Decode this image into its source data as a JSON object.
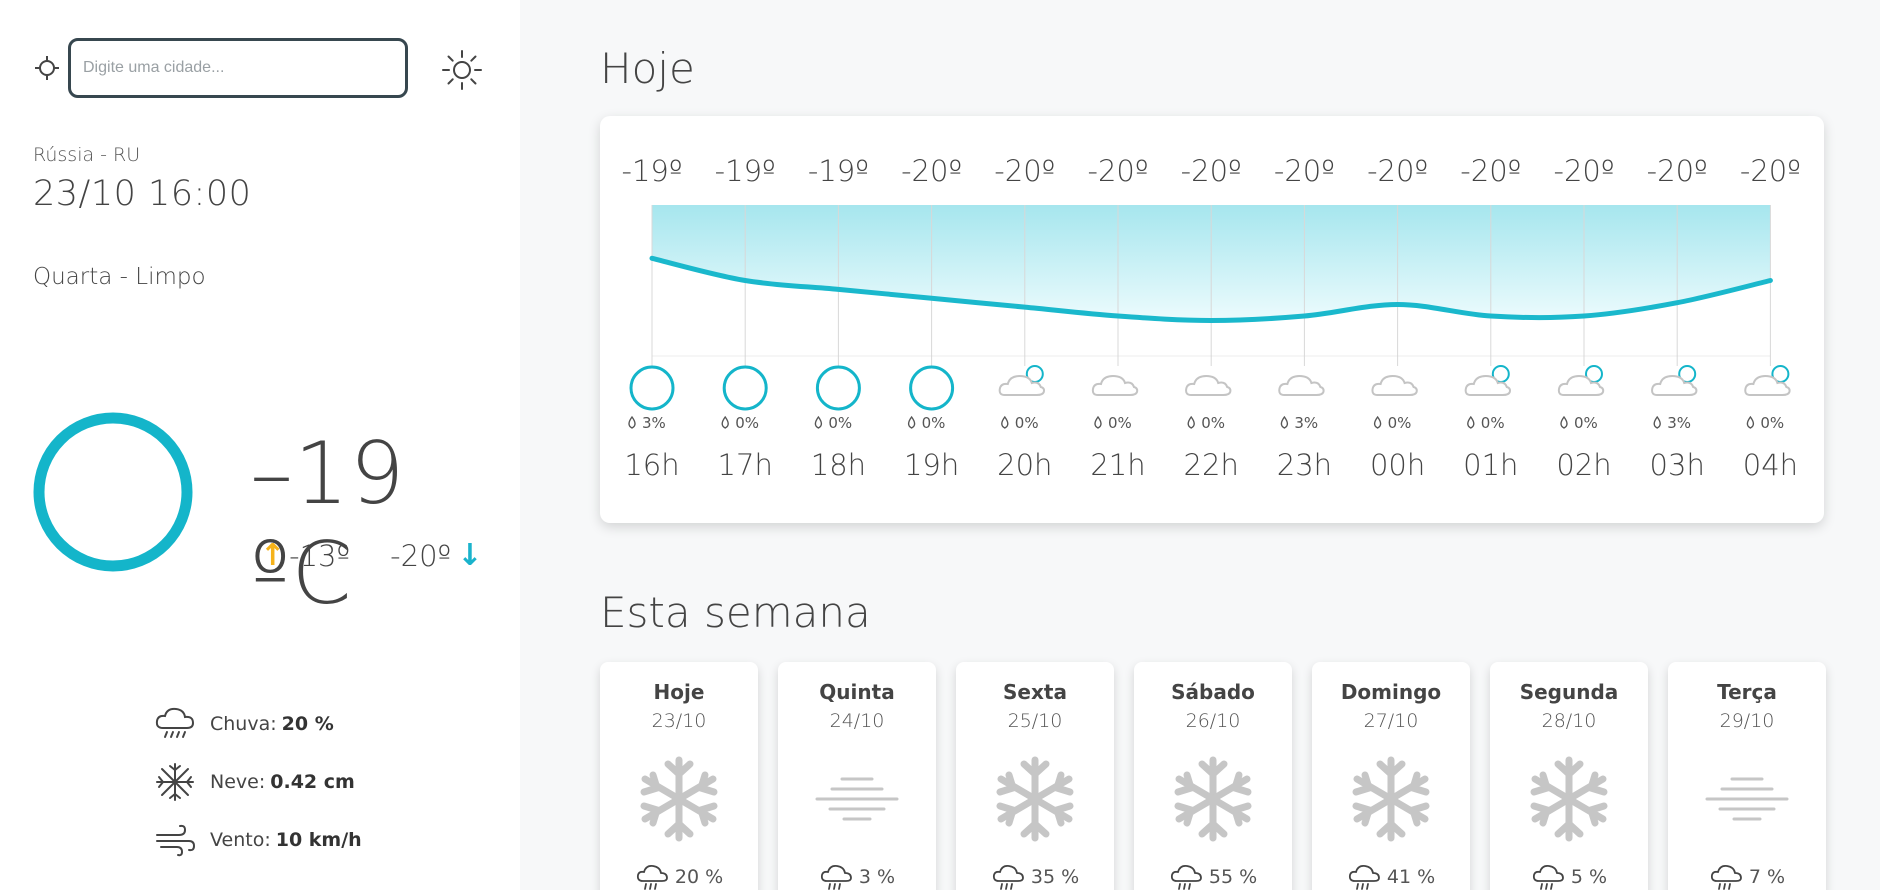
{
  "search": {
    "placeholder": "Digite uma cidade..."
  },
  "location": {
    "country": "Rússia - RU",
    "datetime": "23/10 16:00",
    "description": "Quarta - Limpo"
  },
  "current": {
    "temp": "–19 ºC",
    "max": "-13º",
    "min": "-20º"
  },
  "stats": [
    {
      "label": "Chuva:",
      "value": "20 %",
      "icon": "rain-cloud-icon"
    },
    {
      "label": "Neve:",
      "value": "0.42 cm",
      "icon": "snowflake-icon"
    },
    {
      "label": "Vento:",
      "value": "10 km/h",
      "icon": "wind-icon"
    }
  ],
  "sections": {
    "today": "Hoje",
    "week": "Esta semana"
  },
  "chart_data": {
    "type": "area",
    "x": [
      "16h",
      "17h",
      "18h",
      "19h",
      "20h",
      "21h",
      "22h",
      "23h",
      "00h",
      "01h",
      "02h",
      "03h",
      "04h"
    ],
    "temp_labels": [
      "-19º",
      "-19º",
      "-19º",
      "-20º",
      "-20º",
      "-20º",
      "-20º",
      "-20º",
      "-20º",
      "-20º",
      "-20º",
      "-20º",
      "-20º"
    ],
    "values": [
      -19.2,
      -19.45,
      -19.55,
      -19.65,
      -19.75,
      -19.85,
      -19.9,
      -19.85,
      -19.72,
      -19.85,
      -19.85,
      -19.7,
      -19.45
    ],
    "ylim": [
      -20.3,
      -18.6
    ],
    "rain": [
      "3%",
      "0%",
      "0%",
      "0%",
      "0%",
      "0%",
      "0%",
      "3%",
      "0%",
      "0%",
      "0%",
      "3%",
      "0%"
    ],
    "icons": [
      "clear-night-icon",
      "clear-night-icon",
      "clear-night-icon",
      "clear-night-icon",
      "cloudy-night-icon",
      "cloud-icon",
      "cloud-icon",
      "cloud-icon",
      "cloud-icon",
      "cloudy-night-icon",
      "cloudy-night-icon",
      "cloudy-night-icon",
      "cloudy-night-icon"
    ],
    "colors": {
      "line": "#1ab8cc",
      "fill_top": "#a6e6ee",
      "fill_bottom": "#ecfbfd",
      "grid": "#d8d8d8"
    }
  },
  "week": [
    {
      "name": "Hoje",
      "date": "23/10",
      "icon": "snowflake-icon",
      "rain": "20 %"
    },
    {
      "name": "Quinta",
      "date": "24/10",
      "icon": "fog-icon",
      "rain": "3 %"
    },
    {
      "name": "Sexta",
      "date": "25/10",
      "icon": "snowflake-icon",
      "rain": "35 %"
    },
    {
      "name": "Sábado",
      "date": "26/10",
      "icon": "snowflake-icon",
      "rain": "55 %"
    },
    {
      "name": "Domingo",
      "date": "27/10",
      "icon": "snowflake-icon",
      "rain": "41 %"
    },
    {
      "name": "Segunda",
      "date": "28/10",
      "icon": "snowflake-icon",
      "rain": "5 %"
    },
    {
      "name": "Terça",
      "date": "29/10",
      "icon": "fog-icon",
      "rain": "7 %"
    }
  ]
}
